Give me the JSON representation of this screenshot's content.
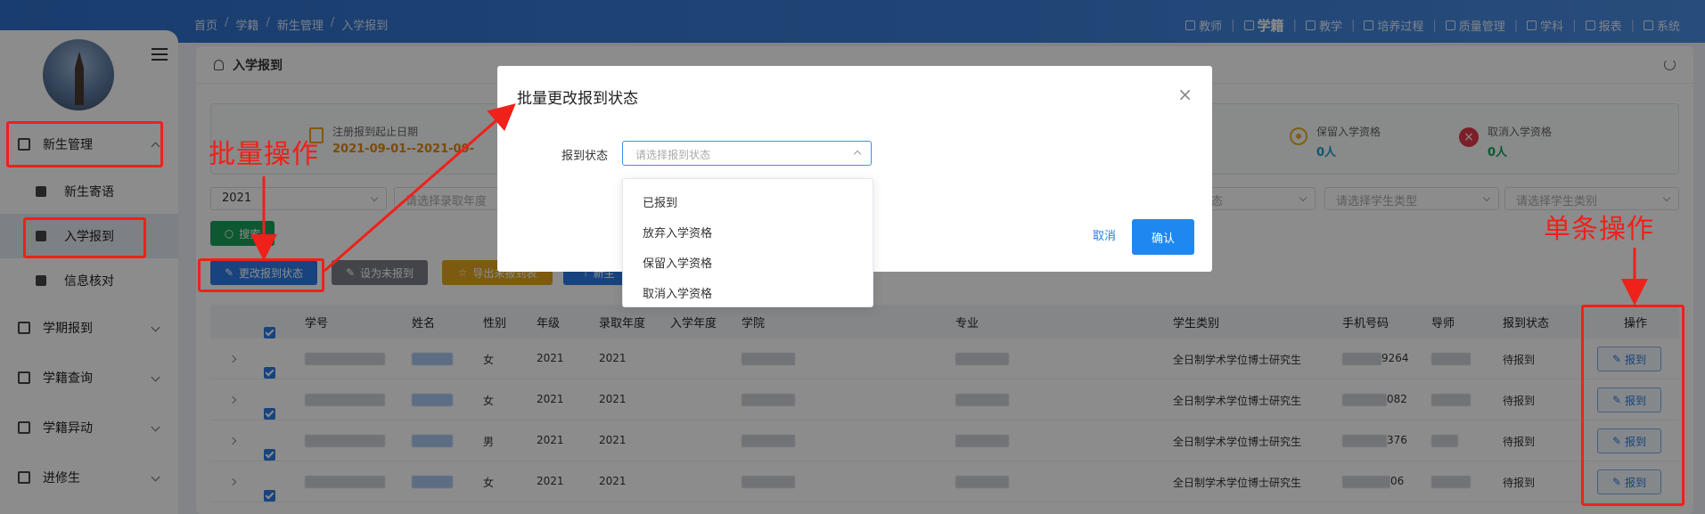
{
  "breadcrumb": [
    "首页",
    "学籍",
    "新生管理",
    "入学报到"
  ],
  "topnav": [
    {
      "label": "教师",
      "active": false
    },
    {
      "label": "学籍",
      "active": true
    },
    {
      "label": "教学",
      "active": false
    },
    {
      "label": "培养过程",
      "active": false
    },
    {
      "label": "质量管理",
      "active": false
    },
    {
      "label": "学科",
      "active": false
    },
    {
      "label": "报表",
      "active": false
    },
    {
      "label": "系统",
      "active": false
    }
  ],
  "sidebar": {
    "items": [
      {
        "label": "新生管理"
      },
      {
        "label": "新生寄语"
      },
      {
        "label": "入学报到"
      },
      {
        "label": "信息核对"
      },
      {
        "label": "学期报到"
      },
      {
        "label": "学籍查询"
      },
      {
        "label": "学籍异动"
      },
      {
        "label": "进修生"
      }
    ]
  },
  "page": {
    "title": "入学报到"
  },
  "stats": {
    "reg_label": "注册报到起止日期",
    "reg_value": "2021-09-01--2021-09-",
    "retain_label": "保留入学资格",
    "retain_value": "0人",
    "cancel_label": "取消入学资格",
    "cancel_value": "0人"
  },
  "filters": {
    "year": "2021",
    "admit_year_placeholder": "请选择录取年度",
    "status_placeholder": "态",
    "stu_type_placeholder": "请选择学生类型",
    "stu_category_placeholder": "请选择学生类别"
  },
  "buttons": {
    "search": "搜索",
    "change_status": "更改报到状态",
    "set_unreported": "设为未报到",
    "export_unreported": "导出未报到表",
    "new": "新生"
  },
  "table": {
    "headers": [
      "学号",
      "姓名",
      "性别",
      "年级",
      "录取年度",
      "入学年度",
      "学院",
      "专业",
      "学生类别",
      "手机号码",
      "导师",
      "报到状态",
      "操作"
    ],
    "rows": [
      {
        "gender": "女",
        "grade": "2021",
        "admit": "2021",
        "category": "全日制学术学位博士研究生",
        "phone_tail": "9264",
        "status": "待报到",
        "action": "报到"
      },
      {
        "gender": "女",
        "grade": "2021",
        "admit": "2021",
        "category": "全日制学术学位博士研究生",
        "phone_tail": "082",
        "status": "待报到",
        "action": "报到"
      },
      {
        "gender": "男",
        "grade": "2021",
        "admit": "2021",
        "category": "全日制学术学位博士研究生",
        "phone_tail": "376",
        "status": "待报到",
        "action": "报到"
      },
      {
        "gender": "女",
        "grade": "2021",
        "admit": "2021",
        "category": "全日制学术学位博士研究生",
        "phone_tail": "06",
        "status": "待报到",
        "action": "报到"
      }
    ]
  },
  "modal": {
    "title": "批量更改报到状态",
    "close": "×",
    "field_label": "报到状态",
    "select_placeholder": "请选择报到状态",
    "options": [
      "已报到",
      "放弃入学资格",
      "保留入学资格",
      "取消入学资格"
    ],
    "cancel": "取消",
    "confirm": "确认"
  },
  "annotations": {
    "batch": "批量操作",
    "single": "单条操作"
  },
  "colors": {
    "primary": "#2c7be5",
    "annotation": "#f0201a",
    "topband": "#3a7fd8"
  }
}
